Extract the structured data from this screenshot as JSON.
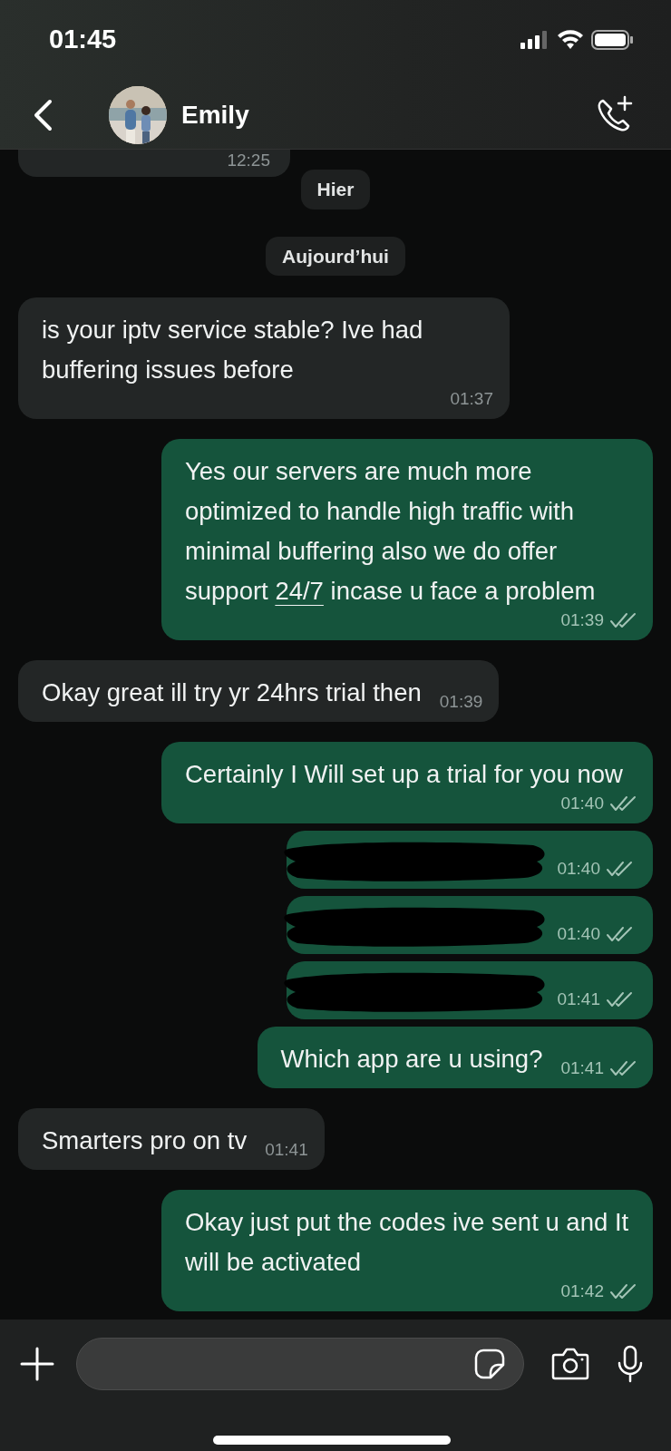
{
  "status_bar": {
    "time": "01:45"
  },
  "header": {
    "contact_name": "Emily"
  },
  "chat": [
    {
      "kind": "partial",
      "outgoing": false,
      "time": "12:25"
    },
    {
      "kind": "date",
      "label": "Hier"
    },
    {
      "kind": "date",
      "label": "Aujourd’hui"
    },
    {
      "kind": "message",
      "outgoing": false,
      "parts": [
        {
          "kind": "plain",
          "text": "is your iptv service stable? Ive had buffering issues before"
        }
      ],
      "time": "01:37"
    },
    {
      "kind": "message",
      "outgoing": true,
      "parts": [
        {
          "kind": "plain",
          "text": "Yes our servers are much more optimized to handle high traffic with minimal buffering also we do offer support "
        },
        {
          "kind": "link",
          "text": "24/7"
        },
        {
          "kind": "plain",
          "text": " incase u face a problem"
        }
      ],
      "time": "01:39",
      "read": false
    },
    {
      "kind": "message",
      "outgoing": false,
      "parts": [
        {
          "kind": "plain",
          "text": "Okay great ill try yr 24hrs trial then"
        }
      ],
      "time": "01:39"
    },
    {
      "kind": "message",
      "outgoing": true,
      "parts": [
        {
          "kind": "plain",
          "text": "Certainly I Will set up a trial for you now"
        }
      ],
      "time": "01:40",
      "read": false
    },
    {
      "kind": "redacted",
      "outgoing": true,
      "time": "01:40",
      "read": false
    },
    {
      "kind": "redacted",
      "outgoing": true,
      "time": "01:40",
      "read": false
    },
    {
      "kind": "redacted",
      "outgoing": true,
      "time": "01:41",
      "read": false
    },
    {
      "kind": "message",
      "outgoing": true,
      "parts": [
        {
          "kind": "plain",
          "text": "Which app are u using?"
        }
      ],
      "time": "01:41",
      "read": false
    },
    {
      "kind": "message",
      "outgoing": false,
      "parts": [
        {
          "kind": "plain",
          "text": "Smarters pro on tv"
        }
      ],
      "time": "01:41"
    },
    {
      "kind": "message",
      "outgoing": true,
      "parts": [
        {
          "kind": "plain",
          "text": "Okay just put the codes ive sent u and It will be activated"
        }
      ],
      "time": "01:42",
      "read": false
    }
  ]
}
